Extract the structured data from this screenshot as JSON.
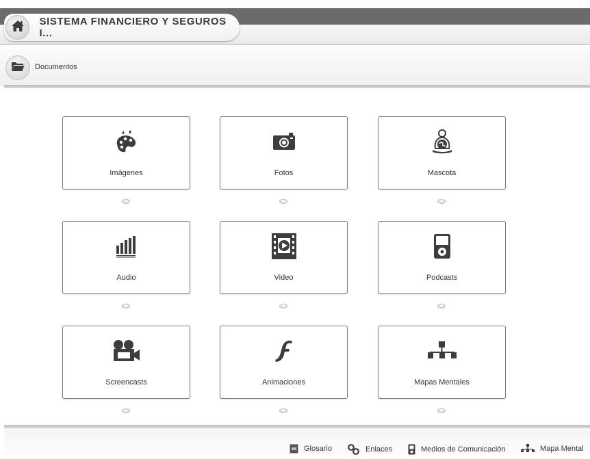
{
  "header": {
    "title": "SISTEMA FINANCIERO Y SEGUROS I..."
  },
  "breadcrumb": {
    "label": "Documentos"
  },
  "tiles": [
    {
      "label": "Imágenes",
      "icon": "palette-icon"
    },
    {
      "label": "Fotos",
      "icon": "camera-icon"
    },
    {
      "label": "Mascota",
      "icon": "mascot-icon"
    },
    {
      "label": "Audio",
      "icon": "audio-bars-icon"
    },
    {
      "label": "Video",
      "icon": "film-play-icon"
    },
    {
      "label": "Podcasts",
      "icon": "media-player-icon"
    },
    {
      "label": "Screencasts",
      "icon": "video-camera-icon"
    },
    {
      "label": "Animaciones",
      "icon": "flash-icon"
    },
    {
      "label": "Mapas Mentales",
      "icon": "mind-map-icon"
    }
  ],
  "footer": {
    "links": [
      {
        "label": "Glosario",
        "icon": "glossary-icon"
      },
      {
        "label": "Enlaces",
        "icon": "link-icon"
      },
      {
        "label": "Medios de Comunicación",
        "icon": "media-device-icon"
      },
      {
        "label": "Mapa Mental",
        "icon": "mind-map-icon"
      }
    ]
  },
  "colors": {
    "header_strip": "#6b6b6b",
    "icon_dark": "#3d3d3d",
    "tile_border": "#7b7b7b"
  }
}
